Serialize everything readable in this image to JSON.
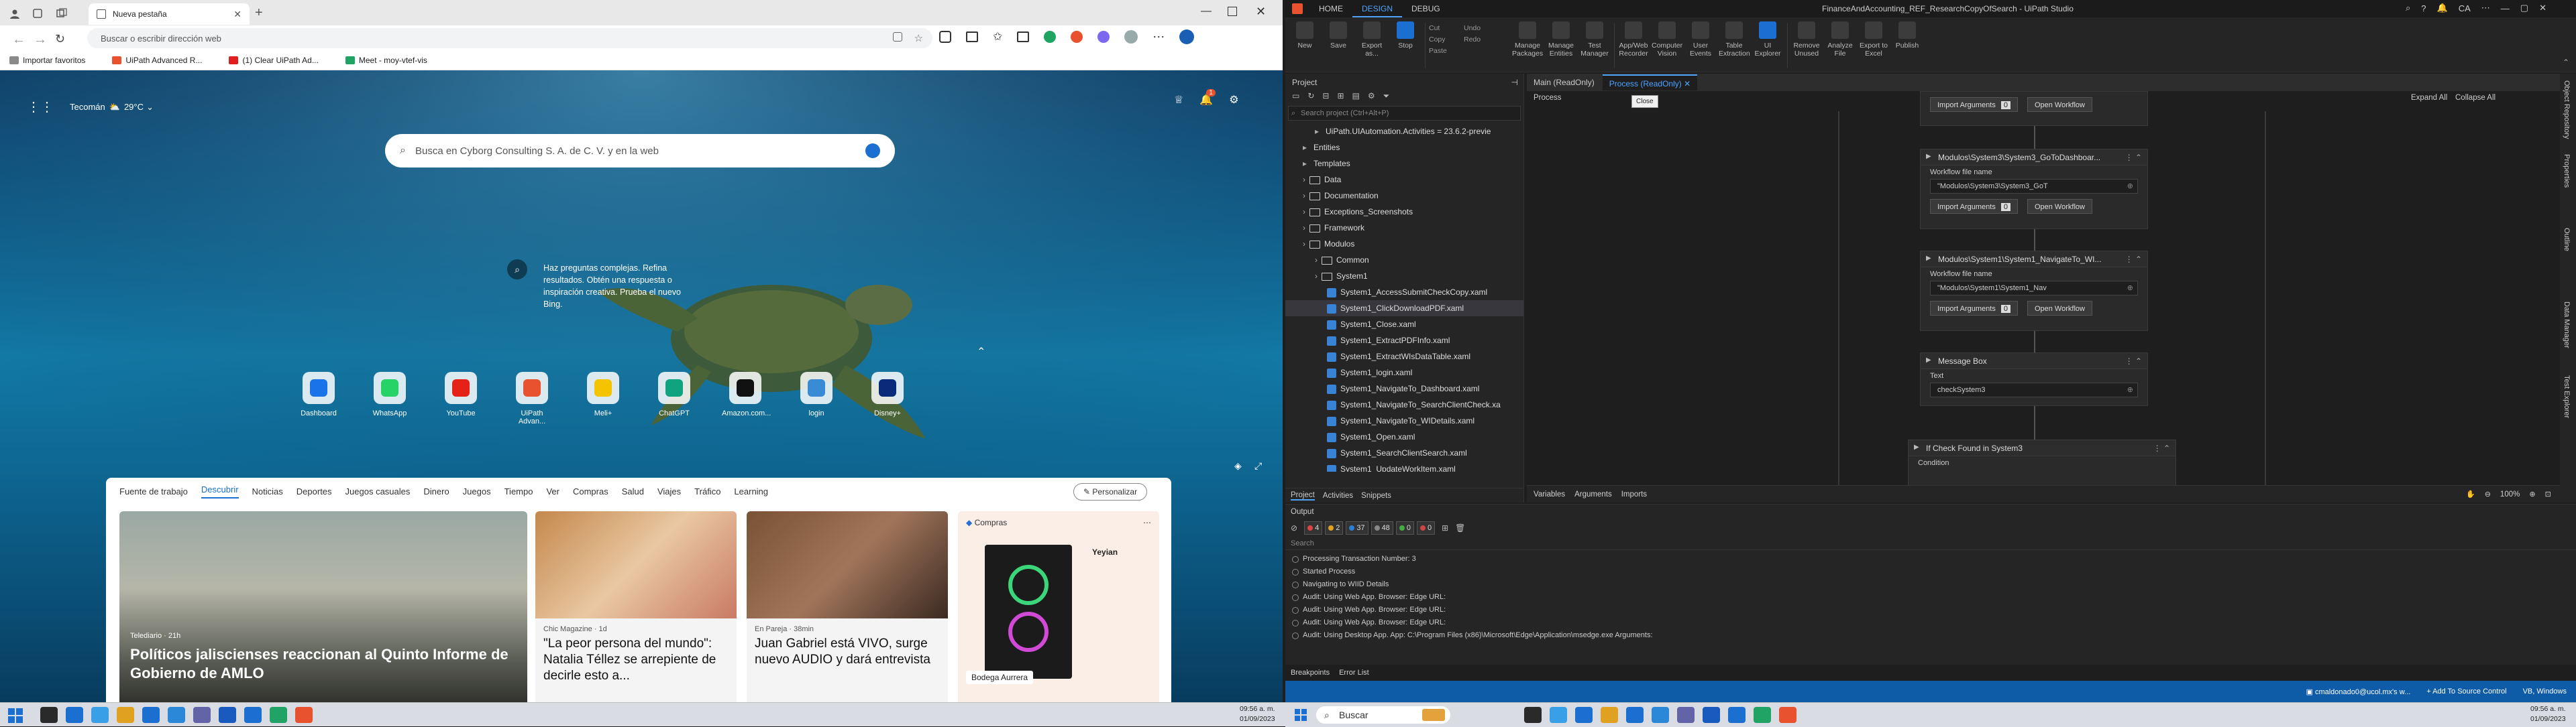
{
  "edge": {
    "tab_title": "Nueva pestaña",
    "address_placeholder": "Buscar o escribir dirección web",
    "favorites": [
      {
        "label": "Importar favoritos",
        "color": "#8a8a8a"
      },
      {
        "label": "UiPath Advanced R...",
        "color": "#e8522f"
      },
      {
        "label": "(1) Clear UiPath Ad...",
        "color": "#e02020"
      },
      {
        "label": "Meet - moy-vtef-vis",
        "color": "#1fa463"
      }
    ],
    "weather": {
      "city": "Tecomán",
      "temp": "29°C"
    },
    "search_placeholder": "Busca en Cyborg Consulting S. A. de C. V. y en la web",
    "bing_bubble": "Haz preguntas complejas. Refina resultados. Obtén una respuesta o inspiración creativa. Prueba el nuevo Bing.",
    "notification_count": "1",
    "tiles": [
      {
        "label": "Dashboard",
        "color": "#1a73e8"
      },
      {
        "label": "WhatsApp",
        "color": "#25d366"
      },
      {
        "label": "YouTube",
        "color": "#e62117"
      },
      {
        "label": "UiPath Advan...",
        "color": "#e8522f"
      },
      {
        "label": "Meli+",
        "color": "#f5c400"
      },
      {
        "label": "ChatGPT",
        "color": "#10a37f"
      },
      {
        "label": "Amazon.com...",
        "color": "#111111"
      },
      {
        "label": "login",
        "color": "#3a8bd6"
      },
      {
        "label": "Disney+",
        "color": "#0a2a7a"
      }
    ],
    "feed_nav": [
      "Fuente de trabajo",
      "Descubrir",
      "Noticias",
      "Deportes",
      "Juegos casuales",
      "Dinero",
      "Juegos",
      "Tiempo",
      "Ver",
      "Compras",
      "Salud",
      "Viajes",
      "Tráfico",
      "Learning"
    ],
    "personalize_label": "Personalizar",
    "cards": [
      {
        "source": "Telediario · 21h",
        "headline": "Políticos jaliscienses reaccionan al Quinto Informe de Gobierno de AMLO"
      },
      {
        "source": "Chic Magazine · 1d",
        "headline": "\"La peor persona del mundo\": Natalia Téllez se arrepiente de decirle esto a..."
      },
      {
        "source": "En Pareja · 38min",
        "headline": "Juan Gabriel está VIVO, surge nuevo AUDIO y dará entrevista"
      }
    ],
    "shop_card": {
      "tag": "Compras",
      "brand": "Yeyian",
      "store": "Bodega Aurrera"
    }
  },
  "taskbar": {
    "search_placeholder": "Buscar",
    "left_time": "09:56 a. m.",
    "left_date": "01/09/2023",
    "right_time": "09:56 a. m.",
    "right_date": "01/09/2023"
  },
  "uipath": {
    "menu_tabs": [
      "HOME",
      "DESIGN",
      "DEBUG"
    ],
    "window_title": "FinanceAndAccounting_REF_ResearchCopyOfSearch - UiPath Studio",
    "user_initials": "CA",
    "ribbon": [
      {
        "label": "New",
        "group": 1
      },
      {
        "label": "Save",
        "group": 1
      },
      {
        "label": "Export as...",
        "group": 1
      },
      {
        "label": "Stop",
        "group": 1
      },
      {
        "label": "Manage Packages",
        "group": 2
      },
      {
        "label": "Manage Entities",
        "group": 2
      },
      {
        "label": "Test Manager",
        "group": 2
      },
      {
        "label": "App/Web Recorder",
        "group": 3
      },
      {
        "label": "Computer Vision",
        "group": 3
      },
      {
        "label": "User Events",
        "group": 3
      },
      {
        "label": "Table Extraction",
        "group": 3
      },
      {
        "label": "UI Explorer",
        "group": 3
      },
      {
        "label": "Remove Unused",
        "group": 4
      },
      {
        "label": "Analyze File",
        "group": 4
      },
      {
        "label": "Export to Excel",
        "group": 4
      },
      {
        "label": "Publish",
        "group": 4
      }
    ],
    "edit_items": [
      "Cut",
      "Copy",
      "Paste",
      "Undo",
      "Redo"
    ],
    "project_panel_title": "Project",
    "project_search": "Search project (Ctrl+Alt+P)",
    "tree": [
      {
        "label": "UiPath.UIAutomation.Activities = 23.6.2-previe",
        "indent": 2,
        "kind": "pkg"
      },
      {
        "label": "Entities",
        "indent": 1,
        "kind": "pkg"
      },
      {
        "label": "Templates",
        "indent": 1,
        "kind": "pkg"
      },
      {
        "label": "Data",
        "indent": 1,
        "kind": "folder"
      },
      {
        "label": "Documentation",
        "indent": 1,
        "kind": "folder"
      },
      {
        "label": "Exceptions_Screenshots",
        "indent": 1,
        "kind": "folder"
      },
      {
        "label": "Framework",
        "indent": 1,
        "kind": "folder"
      },
      {
        "label": "Modulos",
        "indent": 1,
        "kind": "folder"
      },
      {
        "label": "Common",
        "indent": 2,
        "kind": "folder"
      },
      {
        "label": "System1",
        "indent": 2,
        "kind": "folder"
      },
      {
        "label": "System1_AccessSubmitCheckCopy.xaml",
        "indent": 3,
        "kind": "xaml"
      },
      {
        "label": "System1_ClickDownloadPDF.xaml",
        "indent": 3,
        "kind": "xaml",
        "selected": true
      },
      {
        "label": "System1_Close.xaml",
        "indent": 3,
        "kind": "xaml"
      },
      {
        "label": "System1_ExtractPDFInfo.xaml",
        "indent": 3,
        "kind": "xaml"
      },
      {
        "label": "System1_ExtractWIsDataTable.xaml",
        "indent": 3,
        "kind": "xaml"
      },
      {
        "label": "System1_login.xaml",
        "indent": 3,
        "kind": "xaml"
      },
      {
        "label": "System1_NavigateTo_Dashboard.xaml",
        "indent": 3,
        "kind": "xaml"
      },
      {
        "label": "System1_NavigateTo_SearchClientCheck.xa",
        "indent": 3,
        "kind": "xaml"
      },
      {
        "label": "System1_NavigateTo_WIDetails.xaml",
        "indent": 3,
        "kind": "xaml"
      },
      {
        "label": "System1_Open.xaml",
        "indent": 3,
        "kind": "xaml"
      },
      {
        "label": "System1_SearchClientSearch.xaml",
        "indent": 3,
        "kind": "xaml"
      },
      {
        "label": "System1_UpdateWorkItem.xaml",
        "indent": 3,
        "kind": "xaml"
      }
    ],
    "project_bottom_tabs": [
      "Project",
      "Activities",
      "Snippets"
    ],
    "doc_tabs": [
      "Main (ReadOnly)",
      "Process (ReadOnly)"
    ],
    "close_tooltip": "Close",
    "breadcrumb": "Process",
    "expand_all": "Expand All",
    "collapse_all": "Collapse All",
    "activities": [
      {
        "title": "",
        "label": "",
        "value": "",
        "buttons": [
          "Import Arguments",
          "Open Workflow"
        ]
      },
      {
        "title": "Modulos\\System3\\System3_GoToDashboar...",
        "label": "Workflow file name",
        "value": "\"Modulos\\System3\\System3_GoT",
        "buttons": [
          "Import Arguments",
          "Open Workflow"
        ]
      },
      {
        "title": "Modulos\\System1\\System1_NavigateTo_WI...",
        "label": "Workflow file name",
        "value": "\"Modulos\\System1\\System1_Nav",
        "buttons": [
          "Import Arguments",
          "Open Workflow"
        ]
      },
      {
        "title": "Message Box",
        "label": "Text",
        "value": "checkSystem3",
        "buttons": []
      },
      {
        "title": "If Check Found in System3",
        "label": "Condition",
        "value": "",
        "buttons": []
      }
    ],
    "import_count": "0",
    "variables_tabs": [
      "Variables",
      "Arguments",
      "Imports"
    ],
    "zoom": "100%",
    "output_title": "Output",
    "output_filters": [
      "4",
      "2",
      "37",
      "48",
      "0",
      "0"
    ],
    "output_search": "Search",
    "output_lines": [
      "Processing Transaction Number: 3",
      "Started Process",
      "Navigating to WIID Details",
      "Audit: Using Web App. Browser: Edge URL:",
      "Audit: Using Web App. Browser: Edge URL:",
      "Audit: Using Web App. Browser: Edge URL:",
      "Audit: Using Desktop App. App: C:\\Program Files (x86)\\Microsoft\\Edge\\Application\\msedge.exe Arguments:"
    ],
    "bottom_tabs": [
      "Breakpoints",
      "Error List"
    ],
    "status_items": [
      "cmaldonado0@ucol.mx's w...",
      "+ Add To Source Control",
      "VB, Windows"
    ],
    "right_sidebar": [
      "Object Repository",
      "Properties",
      "Outline",
      "Data Manager",
      "Test Explorer"
    ]
  }
}
